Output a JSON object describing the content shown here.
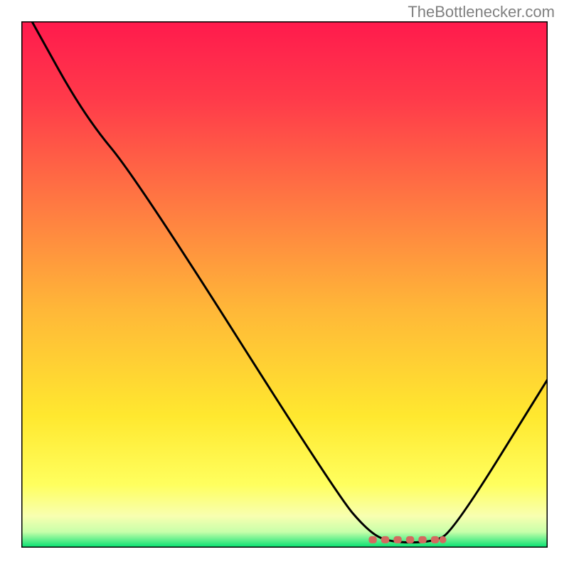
{
  "watermark": "TheBottlenecker.com",
  "chart_data": {
    "type": "line",
    "title": "",
    "xlabel": "",
    "ylabel": "",
    "xlim": [
      0,
      100
    ],
    "ylim": [
      0,
      100
    ],
    "background_gradient": {
      "stops": [
        {
          "offset": 0,
          "color": "#ff1a4d"
        },
        {
          "offset": 15,
          "color": "#ff3b4a"
        },
        {
          "offset": 35,
          "color": "#ff7a42"
        },
        {
          "offset": 55,
          "color": "#ffb838"
        },
        {
          "offset": 75,
          "color": "#ffe82f"
        },
        {
          "offset": 88,
          "color": "#ffff5e"
        },
        {
          "offset": 94,
          "color": "#f8ffb0"
        },
        {
          "offset": 97,
          "color": "#c8ffaa"
        },
        {
          "offset": 100,
          "color": "#00e070"
        }
      ]
    },
    "series": [
      {
        "name": "bottleneck-curve",
        "color": "#000000",
        "points": [
          {
            "x": 2,
            "y": 100
          },
          {
            "x": 12,
            "y": 82
          },
          {
            "x": 22,
            "y": 70
          },
          {
            "x": 60,
            "y": 10
          },
          {
            "x": 66,
            "y": 3
          },
          {
            "x": 70,
            "y": 1
          },
          {
            "x": 78,
            "y": 1
          },
          {
            "x": 82,
            "y": 3
          },
          {
            "x": 100,
            "y": 32
          }
        ]
      }
    ],
    "markers": [
      {
        "name": "optimal-range",
        "type": "dash-band",
        "x_start": 66,
        "x_end": 79,
        "y": 1.5,
        "color": "#d4695f"
      }
    ]
  }
}
